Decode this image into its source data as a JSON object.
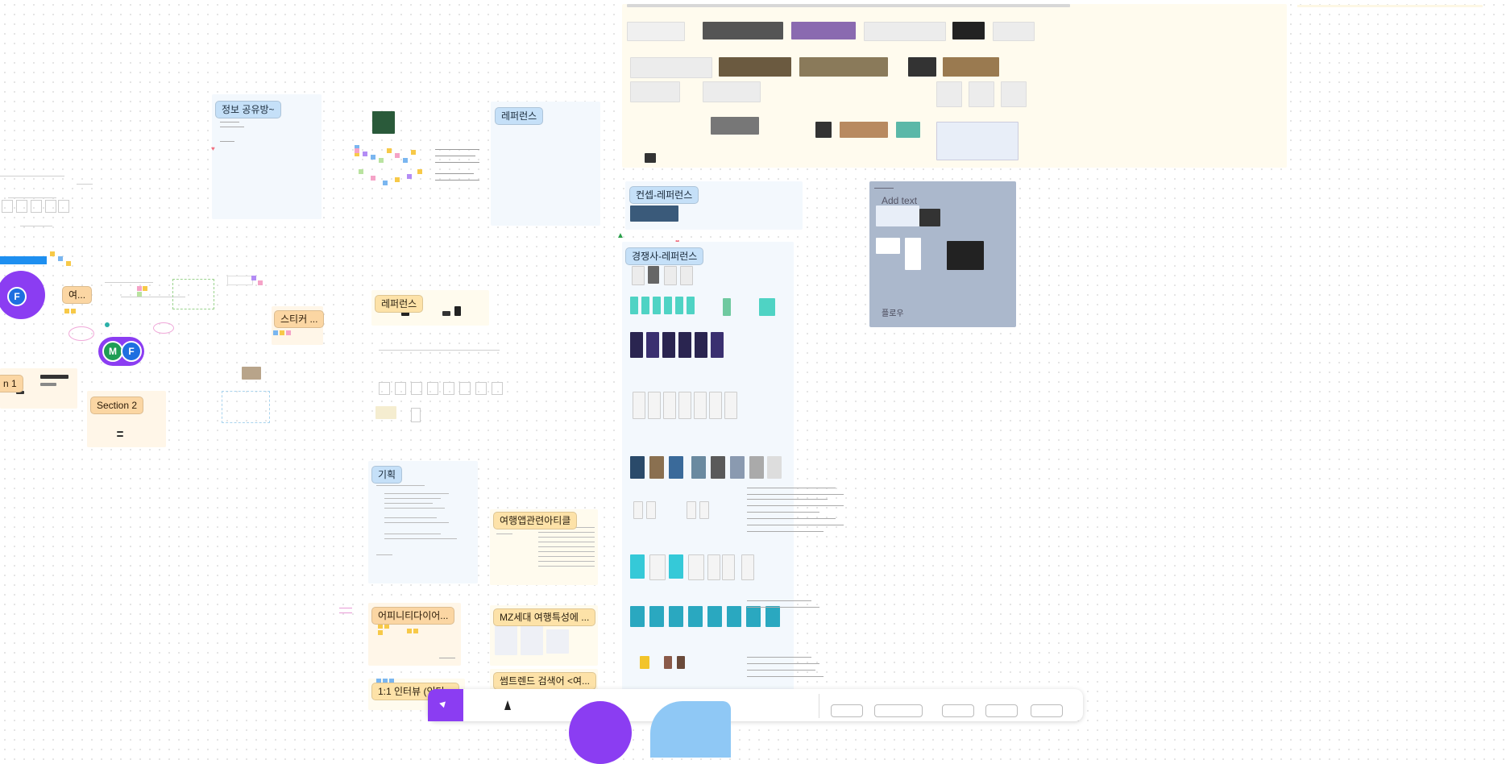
{
  "sections": {
    "info_share": "정보 공유방~",
    "reference_a": "레퍼런스",
    "reference_b": "레퍼런스",
    "concept_ref": "컨셉-레퍼런스",
    "competitor_ref": "경쟁사-레퍼런스",
    "sticker": "스티커 ...",
    "section2": "Section 2",
    "section1_partial": "n 1",
    "yeo_partial": "여...",
    "planning": "기획",
    "travel_app_article": "여행앱관련아티클",
    "affinity": "어피니티다이어...",
    "mz_travel": "MZ세대 여행특성에 ...",
    "some_trend": "썸트렌드 검색어 <여...",
    "interview": "1:1 인터뷰 (인터..."
  },
  "gray_panel": {
    "add_text": "Add text",
    "flow": "플로우"
  },
  "avatars": {
    "f_big": "F",
    "m": "M",
    "f_small": "F"
  },
  "colors": {
    "accent_purple": "#8b3df2",
    "avatar_blue": "#1e6fe0",
    "avatar_green": "#1f9d55",
    "toolbar_select": "#8b3df2"
  },
  "toolbar": {
    "select_tool_icon": "cursor-arrow-icon",
    "pen_tool_icon": "pen-icon",
    "shape_tool_icon": "circle-shape-icon",
    "sticky_tool_icon": "sticky-note-icon"
  }
}
